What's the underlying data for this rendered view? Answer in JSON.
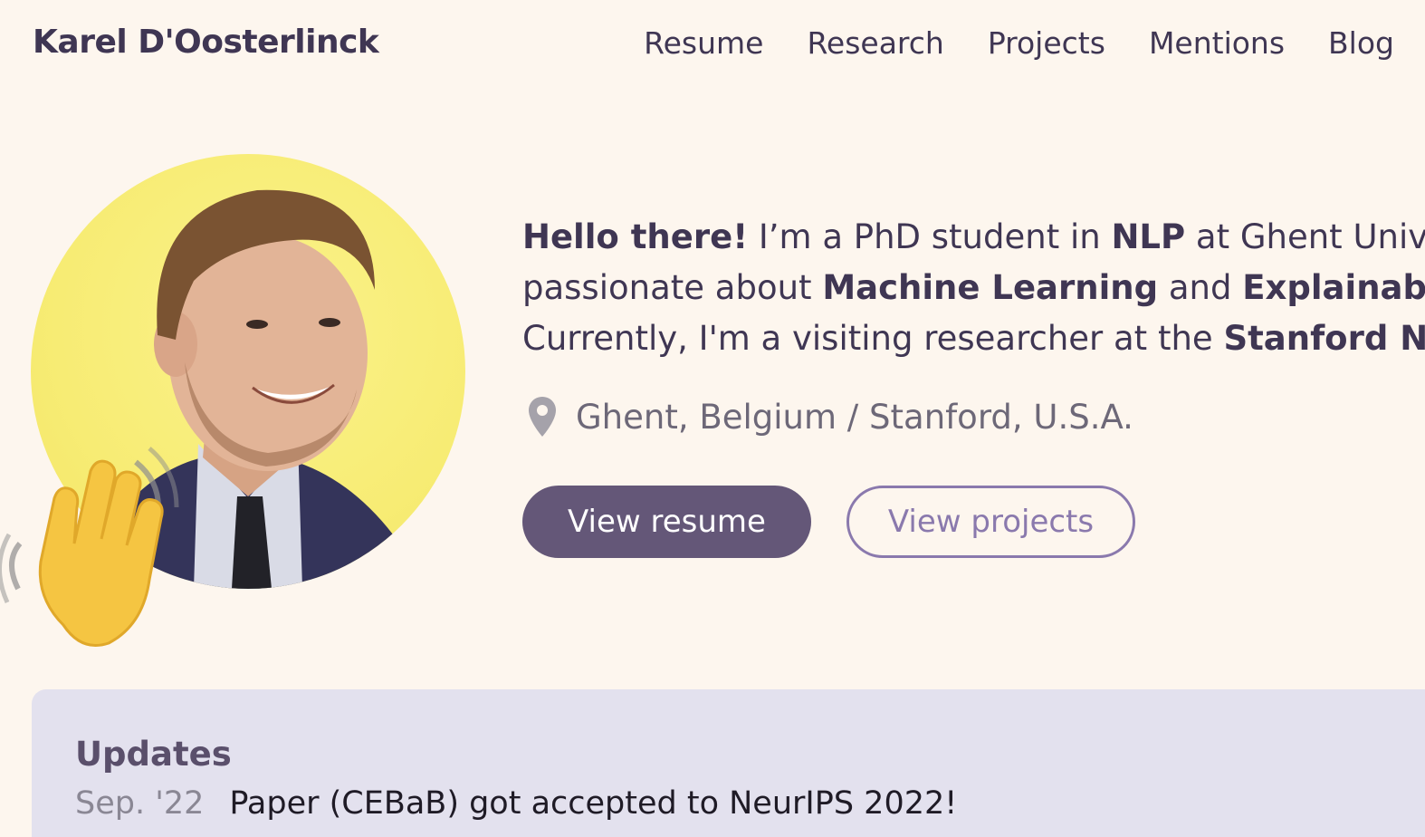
{
  "header": {
    "brand": "Karel D'Oosterlinck",
    "nav": [
      "Resume",
      "Research",
      "Projects",
      "Mentions",
      "Blog"
    ]
  },
  "intro": {
    "line1": [
      {
        "text": "Hello there!",
        "bold": true
      },
      {
        "text": " I’m a PhD student in ",
        "bold": false
      },
      {
        "text": "NLP",
        "bold": true
      },
      {
        "text": " at Ghent Univers",
        "bold": false
      }
    ],
    "line2": [
      {
        "text": "passionate about ",
        "bold": false
      },
      {
        "text": "Machine Learning",
        "bold": true
      },
      {
        "text": " and ",
        "bold": false
      },
      {
        "text": "Explainable A",
        "bold": true
      }
    ],
    "line3": [
      {
        "text": "Currently, I'm a visiting researcher at the ",
        "bold": false
      },
      {
        "text": "Stanford NLP",
        "bold": true
      }
    ]
  },
  "location": {
    "icon": "map-pin-icon",
    "text": "Ghent, Belgium / Stanford, U.S.A."
  },
  "buttons": {
    "resume": "View resume",
    "projects": "View projects"
  },
  "updates": {
    "title": "Updates",
    "items": [
      {
        "date": "Sep. '22",
        "text": "Paper (CEBaB) got accepted to NeurIPS 2022!"
      }
    ]
  },
  "colors": {
    "background": "#fdf6ee",
    "text": "#3f3653",
    "primary_button": "#645778",
    "outline_button": "#8a79ad",
    "updates_panel": "#e3e1ee",
    "avatar_bg": "#f7ec74"
  }
}
